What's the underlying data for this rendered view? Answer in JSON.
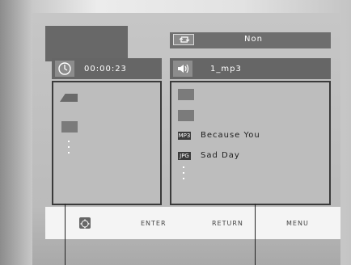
{
  "repeat": {
    "mode_text": "Non"
  },
  "left_panel": {
    "time": "00:00:23"
  },
  "right_panel": {
    "title": "1_mp3",
    "files": [
      {
        "type_label": "MP3",
        "name": "Because You"
      },
      {
        "type_label": "JPG",
        "name": "Sad Day"
      }
    ]
  },
  "bottom_bar": {
    "enter": "ENTER",
    "return": "RETURN",
    "menu": "MENU"
  },
  "icons": {
    "repeat": "repeat-icon",
    "timer": "timer-icon",
    "speaker": "speaker-icon",
    "folder": "folder-icon",
    "navigation": "navigation-pad-icon"
  }
}
